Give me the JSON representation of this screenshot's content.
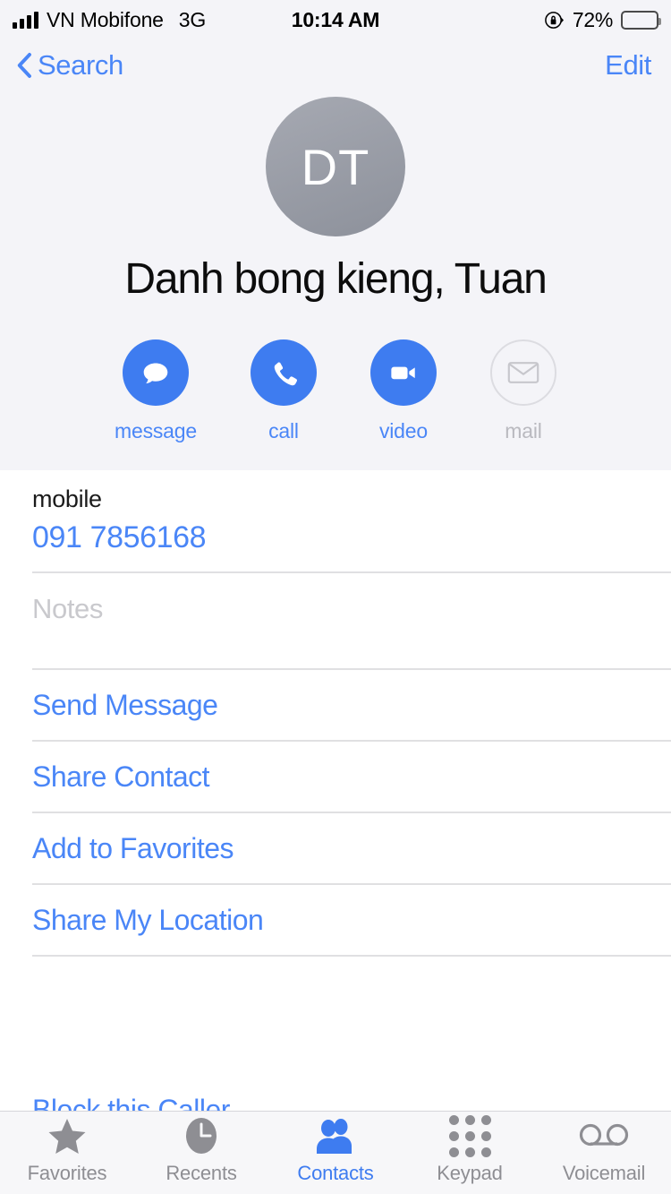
{
  "status_bar": {
    "carrier": "VN Mobifone",
    "network": "3G",
    "time": "10:14 AM",
    "battery_percent": "72%",
    "signal_bars": 4,
    "rotation_lock_icon": "rotation-lock-icon",
    "battery_icon": "battery-icon"
  },
  "nav_bar": {
    "back_label": "Search",
    "back_icon": "chevron-left-icon",
    "edit_label": "Edit"
  },
  "contact": {
    "initials": "DT",
    "name": "Danh bong kieng, Tuan"
  },
  "quick_actions": [
    {
      "label": "message",
      "icon": "message-bubble-icon",
      "enabled": true
    },
    {
      "label": "call",
      "icon": "phone-icon",
      "enabled": true
    },
    {
      "label": "video",
      "icon": "video-camera-icon",
      "enabled": true
    },
    {
      "label": "mail",
      "icon": "envelope-icon",
      "enabled": false
    }
  ],
  "phone": {
    "label": "mobile",
    "number": "091 7856168"
  },
  "notes": {
    "placeholder": "Notes",
    "value": ""
  },
  "actions": [
    {
      "label": "Send Message"
    },
    {
      "label": "Share Contact"
    },
    {
      "label": "Add to Favorites"
    },
    {
      "label": "Share My Location"
    }
  ],
  "block": {
    "label": "Block this Caller"
  },
  "tabs": [
    {
      "label": "Favorites",
      "icon": "star-icon",
      "active": false
    },
    {
      "label": "Recents",
      "icon": "clock-icon",
      "active": false
    },
    {
      "label": "Contacts",
      "icon": "people-icon",
      "active": true
    },
    {
      "label": "Keypad",
      "icon": "keypad-dots-icon",
      "active": false
    },
    {
      "label": "Voicemail",
      "icon": "voicemail-icon",
      "active": false
    }
  ],
  "colors": {
    "accent_blue": "#4a86f7",
    "action_blue": "#3e7cf0",
    "header_background": "#f4f4f8",
    "tab_inactive": "#8e8e93",
    "avatar_gray": "#8d919b"
  }
}
